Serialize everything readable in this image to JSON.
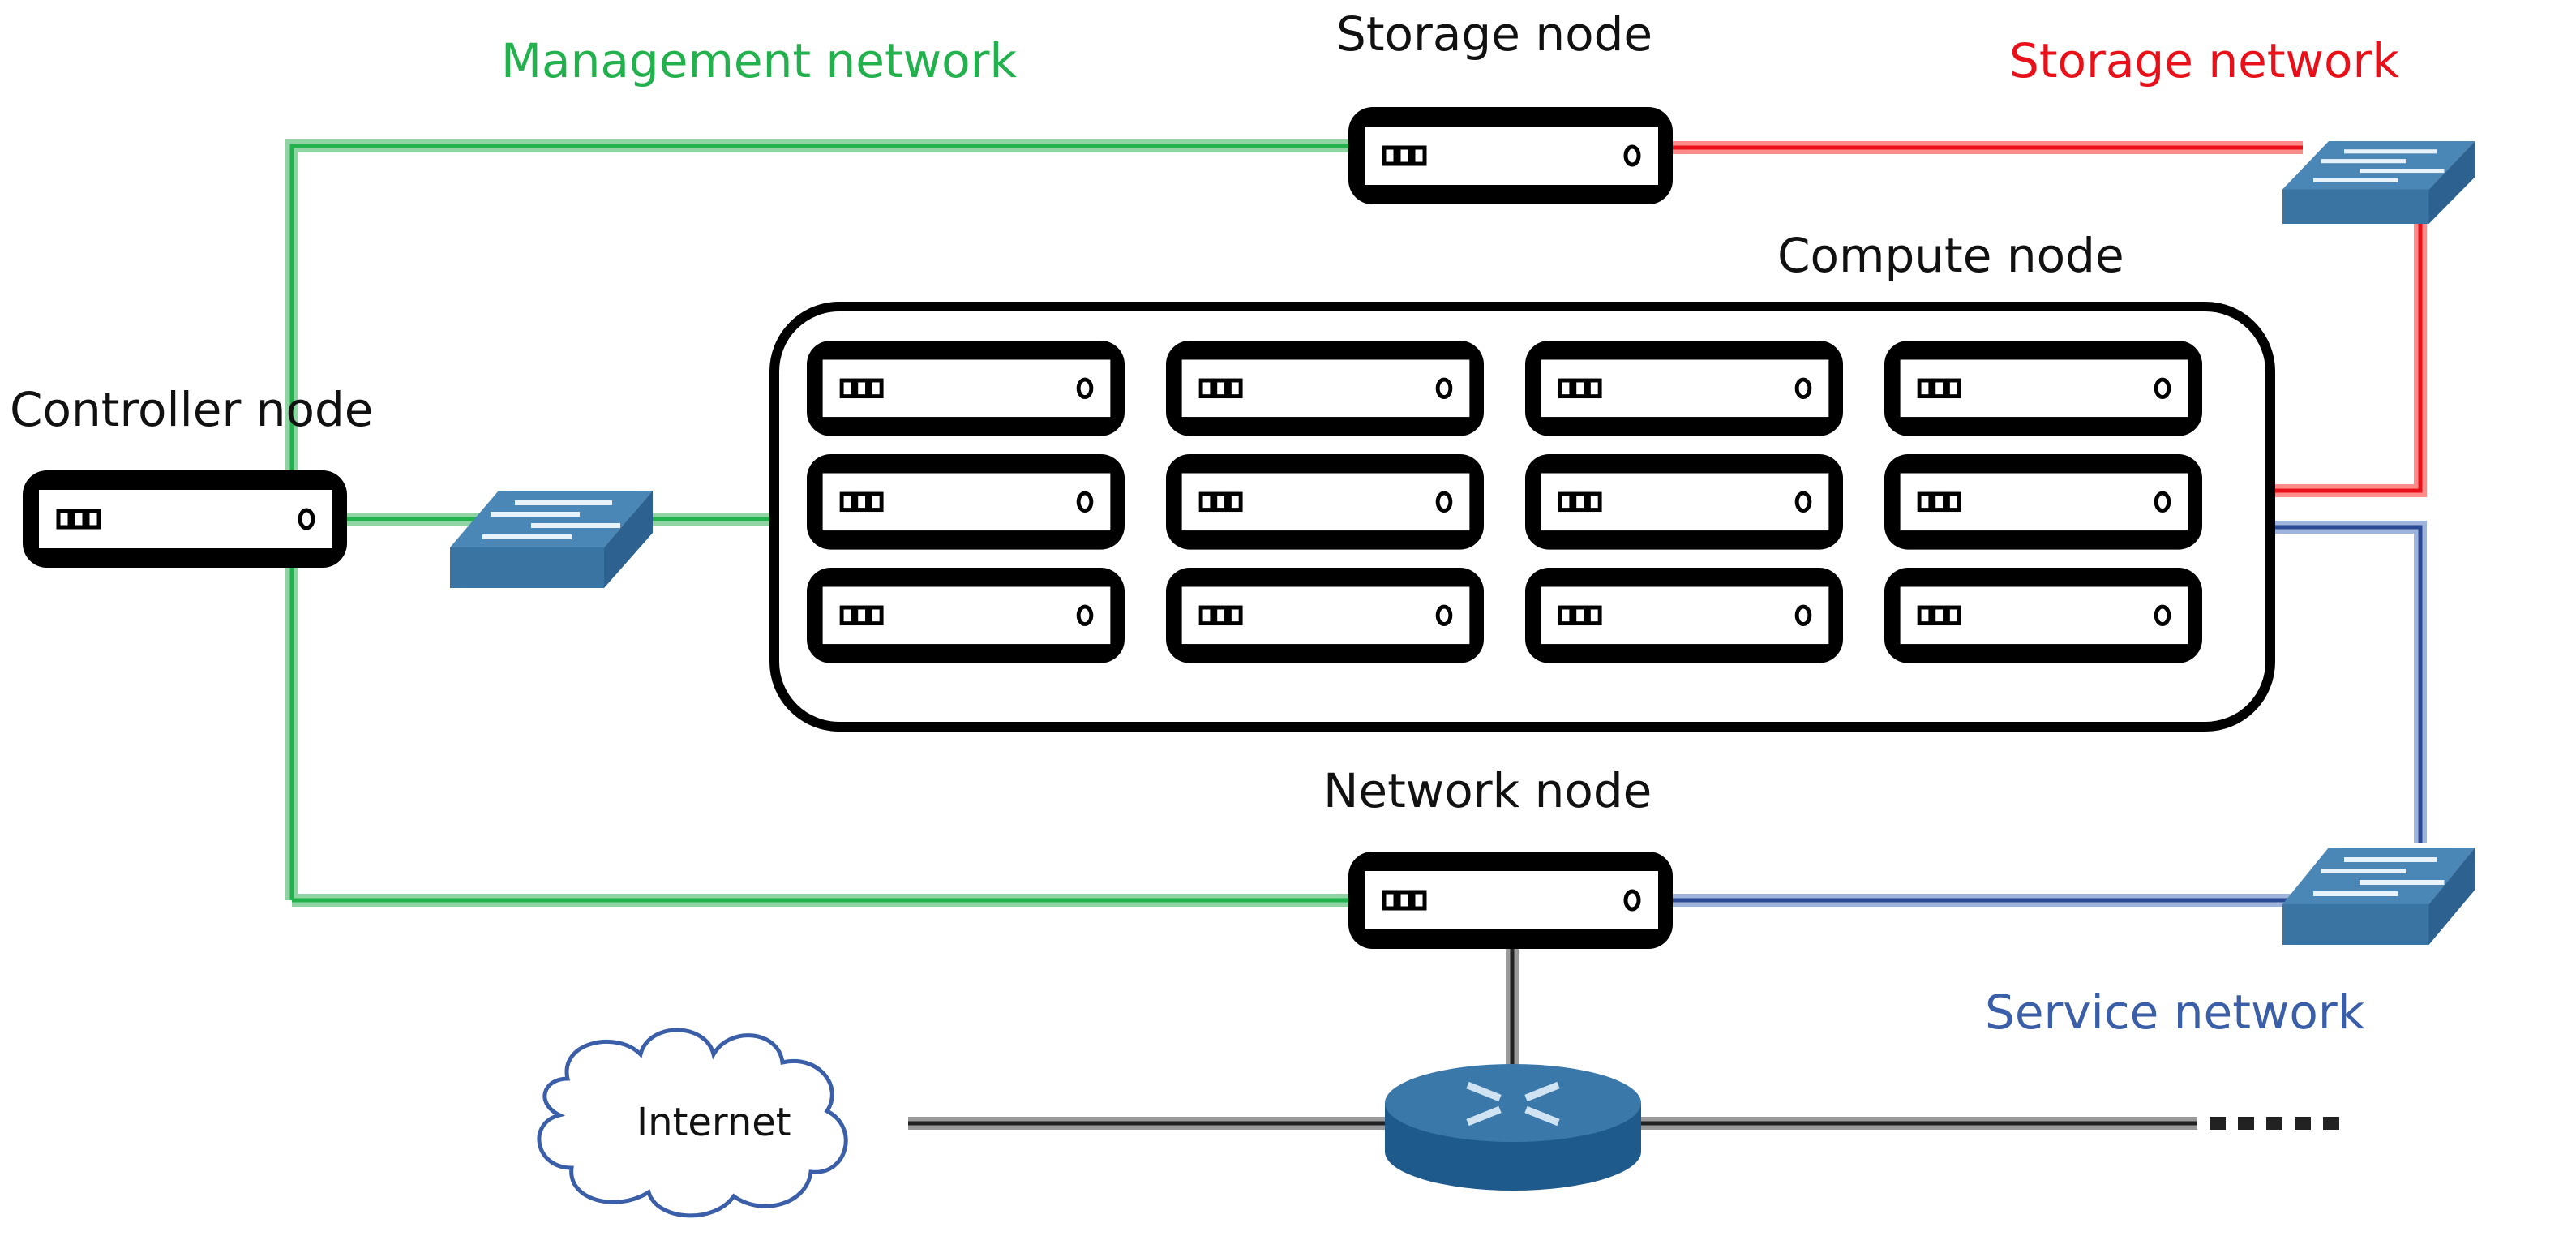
{
  "labels": {
    "management_network": "Management network",
    "storage_node": "Storage node",
    "storage_network": "Storage network",
    "compute_node": "Compute node",
    "controller_node": "Controller node",
    "network_node": "Network node",
    "service_network": "Service network",
    "internet": "Internet"
  },
  "colors": {
    "management": "#22b14c",
    "storage": "#ff2a2a",
    "service": "#3b5ea8",
    "external": "#333333",
    "device_blue": "#3a74a3",
    "server_outline": "#000000"
  },
  "icons": {
    "switch": "network-switch-icon",
    "router": "router-icon",
    "cloud": "cloud-icon",
    "server": "server-icon"
  },
  "compute_grid": {
    "rows": 3,
    "cols": 4
  }
}
